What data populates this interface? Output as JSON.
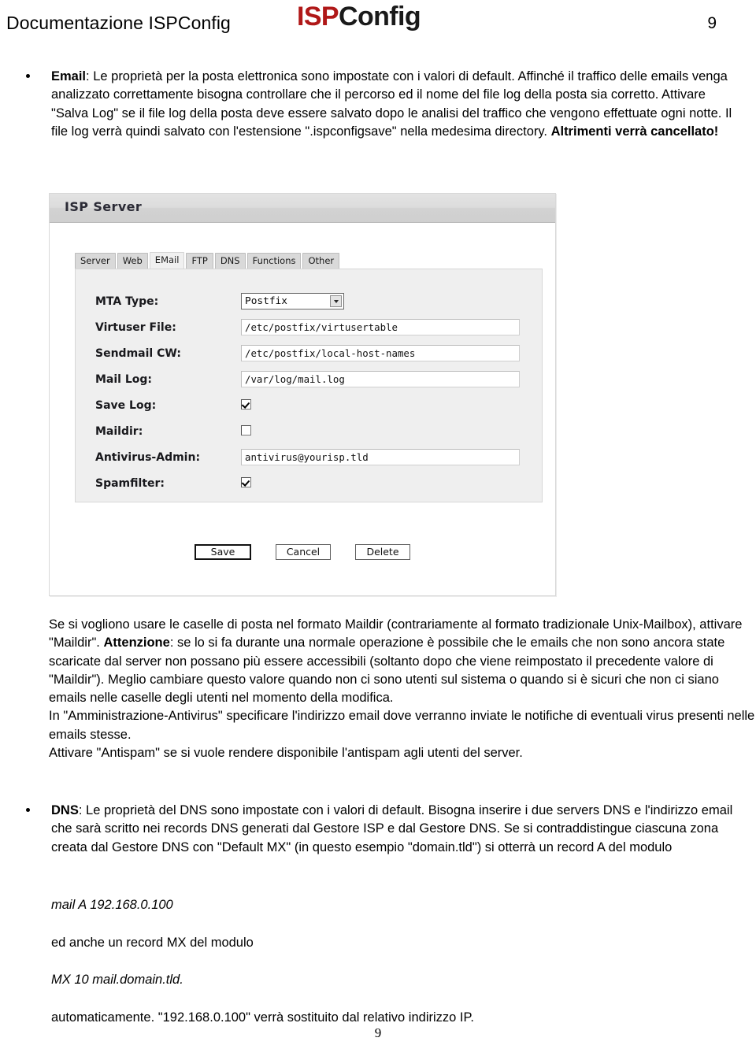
{
  "header": {
    "title": "Documentazione ISPConfig",
    "logo_isp": "ISP",
    "logo_config": "Config",
    "page_number": "9",
    "logo_red": "#b01818"
  },
  "email_bullet": {
    "lead": "Email",
    "line1_rest": ": Le proprietà per la posta elettronica sono impostate con i valori di default. Affinché il",
    "line2": "traffico delle emails venga analizzato correttamente bisogna controllare che il percorso ed il nome",
    "line3": "del file log della posta sia corretto. Attivare \"Salva Log\" se il file log della posta deve essere",
    "line4": "salvato dopo le analisi del traffico che vengono effettuate ogni notte. Il file log verrà quindi salvato",
    "line5_a": "con l'estensione \".ispconfigsave\" nella medesima directory. ",
    "line5_bold": "Altrimenti verrà cancellato!"
  },
  "isp_server": {
    "window_title": "ISP Server",
    "tabs": [
      {
        "label": "Server",
        "active": false
      },
      {
        "label": "Web",
        "active": false
      },
      {
        "label": "EMail",
        "active": true
      },
      {
        "label": "FTP",
        "active": false
      },
      {
        "label": "DNS",
        "active": false
      },
      {
        "label": "Functions",
        "active": false
      },
      {
        "label": "Other",
        "active": false
      }
    ],
    "fields": [
      {
        "label": "MTA Type:",
        "type": "select",
        "value": "Postfix"
      },
      {
        "label": "Virtuser File:",
        "type": "text",
        "value": "/etc/postfix/virtusertable"
      },
      {
        "label": "Sendmail CW:",
        "type": "text",
        "value": "/etc/postfix/local-host-names"
      },
      {
        "label": "Mail Log:",
        "type": "text",
        "value": "/var/log/mail.log"
      },
      {
        "label": "Save Log:",
        "type": "checkbox",
        "checked": true
      },
      {
        "label": "Maildir:",
        "type": "checkbox",
        "checked": false
      },
      {
        "label": "Antivirus-Admin:",
        "type": "text",
        "value": "antivirus@yourisp.tld"
      },
      {
        "label": "Spamfilter:",
        "type": "checkbox",
        "checked": true
      }
    ],
    "buttons": [
      {
        "label": "Save",
        "primary": true
      },
      {
        "label": "Cancel",
        "primary": false
      },
      {
        "label": "Delete",
        "primary": false
      }
    ]
  },
  "maildir_text": {
    "line1": "Se si vogliono usare le caselle di posta nel formato Maildir (contrariamente al formato tradizionale",
    "line2_a": "Unix-Mailbox), attivare \"Maildir\". ",
    "line2_bold": "Attenzione",
    "line2_b": ": se lo si fa durante una normale operazione è",
    "line3": "possibile che le emails che non sono ancora state scaricate dal server non possano più essere",
    "line4": "accessibili (soltanto dopo che viene reimpostato il precedente valore di \"Maildir\"). Meglio",
    "line5": "cambiare questo valore quando non ci sono utenti sul sistema o quando si è sicuri che non ci",
    "line6": "siano emails nelle caselle degli utenti nel momento della modifica.",
    "line7": "In \"Amministrazione-Antivirus\" specificare l'indirizzo email dove verranno inviate le notifiche di",
    "line8": "eventuali virus presenti nelle emails stesse.",
    "line9": "Attivare \"Antispam\" se si vuole rendere disponibile l'antispam agli utenti del server."
  },
  "dns_bullet": {
    "lead": "DNS",
    "line1_rest": ": Le proprietà del DNS sono impostate con i valori di default. Bisogna inserire i due servers",
    "line2": "DNS e l'indirizzo email che sarà scritto nei records DNS generati dal Gestore ISP e dal Gestore",
    "line3": "DNS.  Se si contraddistingue ciascuna zona creata dal Gestore DNS con \"Default MX\" (in questo",
    "line4": "esempio \"domain.tld\") si otterrà un record A del modulo"
  },
  "records": {
    "a_record": "mail  A 192.168.0.100",
    "middle_text": "ed anche un record MX del modulo",
    "mx_record": "MX 10 mail.domain.tld.",
    "closing": "automaticamente. \"192.168.0.100\" verrà sostituito dal relativo indirizzo IP."
  },
  "footer": {
    "page_number": "9"
  }
}
